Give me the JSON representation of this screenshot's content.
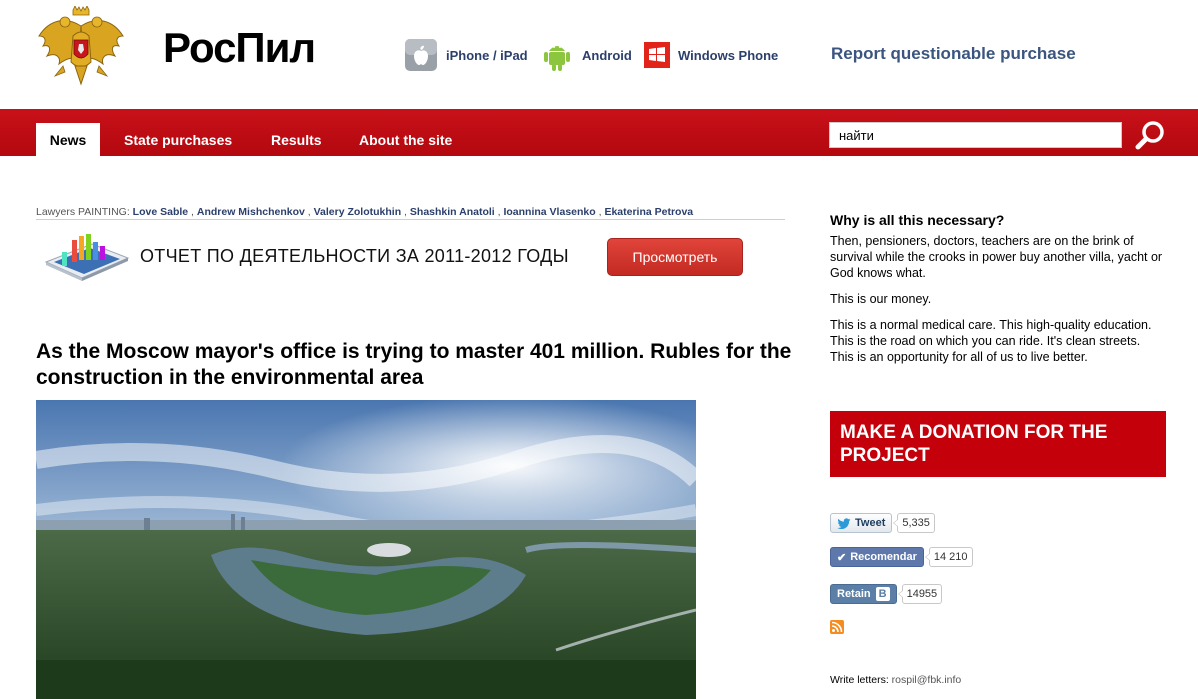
{
  "header": {
    "logo_text": "РосПил",
    "apps": [
      {
        "label": "iPhone / iPad",
        "icon": "apple-icon"
      },
      {
        "label": "Android",
        "icon": "android-icon"
      },
      {
        "label": "Windows Phone",
        "icon": "windows-icon"
      }
    ],
    "report_link": "Report questionable purchase"
  },
  "nav": {
    "tabs": [
      "News",
      "State purchases",
      "Results",
      "About the site"
    ],
    "active": "News",
    "search_value": "найти"
  },
  "lawyers": {
    "prefix": "Lawyers PAINTING:",
    "names": [
      "Love Sable",
      "Andrew Mishchenkov",
      "Valery Zolotukhin",
      "Shashkin Anatoli",
      "Ioannina Vlasenko",
      "Ekaterina Petrova"
    ]
  },
  "report_banner": {
    "text": "ОТЧЕТ ПО ДЕЯТЕЛЬНОСТИ ЗА 2011-2012 ГОДЫ",
    "button": "Просмотреть"
  },
  "article": {
    "title": "As the Moscow mayor's office is trying to master 401 million. Rubles for the construction in the environmental area"
  },
  "sidebar": {
    "question": "Why is all this necessary?",
    "p1": "Then, pensioners, doctors, teachers are on the brink of survival while the crooks in power buy another villa, yacht or God knows what.",
    "p2": "This is our money.",
    "p3": "This is a normal medical care. This high-quality education. This is the road on which you can ride. It's clean streets. This is an opportunity for all of us to live better.",
    "donate": "MAKE A DONATION FOR THE PROJECT",
    "tweet_label": "Tweet",
    "tweet_count": "5,335",
    "recommend_label": "Recomendar",
    "recommend_count": "14 210",
    "vk_label": "Retain",
    "vk_letter": "B",
    "vk_count": "14955",
    "write_label": "Write letters:",
    "write_email": "rospil@fbk.info"
  },
  "colors": {
    "nav_red": "#c9111a",
    "donate_red": "#c4000b",
    "link_blue": "#3b5580"
  }
}
